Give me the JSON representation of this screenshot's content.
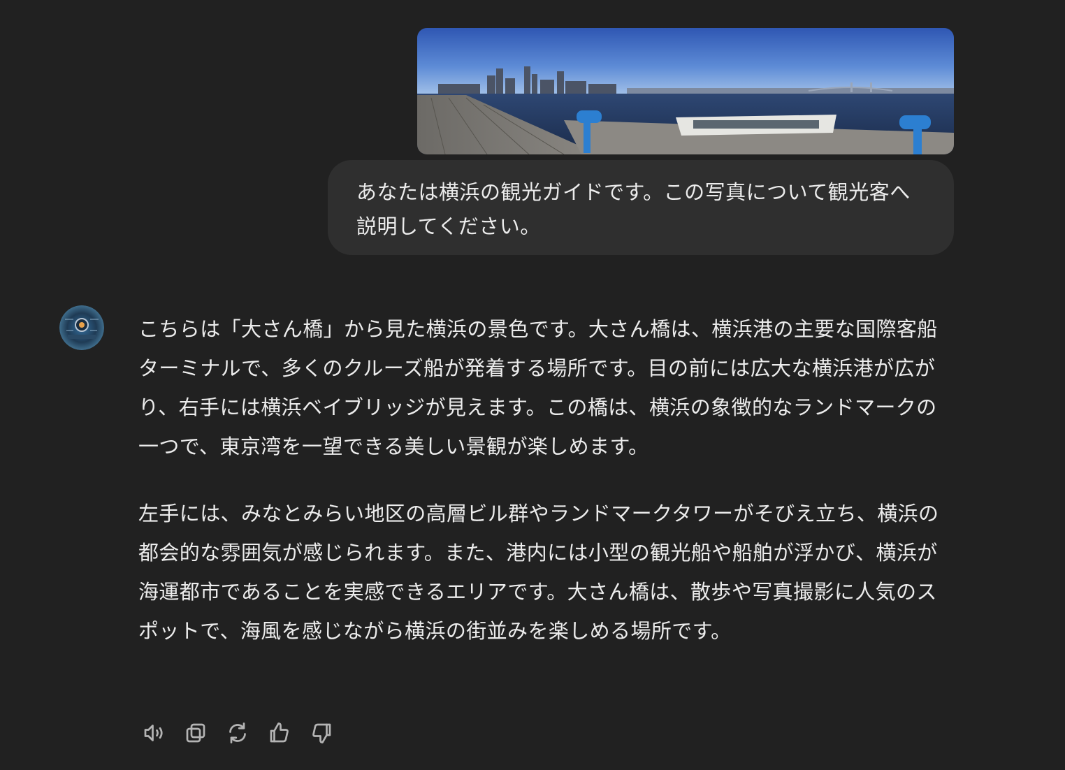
{
  "conversation": {
    "user_message": {
      "image_alt": "横浜港のパノラマ写真",
      "text": "あなたは横浜の観光ガイドです。この写真について観光客へ説明してください。"
    },
    "assistant_message": {
      "paragraphs": [
        "こちらは「大さん橋」から見た横浜の景色です。大さん橋は、横浜港の主要な国際客船ターミナルで、多くのクルーズ船が発着する場所です。目の前には広大な横浜港が広がり、右手には横浜ベイブリッジが見えます。この橋は、横浜の象徴的なランドマークの一つで、東京湾を一望できる美しい景観が楽しめます。",
        "左手には、みなとみらい地区の高層ビル群やランドマークタワーがそびえ立ち、横浜の都会的な雰囲気が感じられます。また、港内には小型の観光船や船舶が浮かび、横浜が海運都市であることを実感できるエリアです。大さん橋は、散歩や写真撮影に人気のスポットで、海風を感じながら横浜の街並みを楽しめる場所です。"
      ]
    }
  },
  "actions": [
    {
      "icon": "speaker-icon"
    },
    {
      "icon": "copy-icon"
    },
    {
      "icon": "regenerate-icon"
    },
    {
      "icon": "thumbs-up-icon"
    },
    {
      "icon": "thumbs-down-icon"
    }
  ],
  "colors": {
    "background": "#212121",
    "user_bubble": "#2f2f2f",
    "text": "#ececec",
    "icon": "#b4b4b4"
  }
}
